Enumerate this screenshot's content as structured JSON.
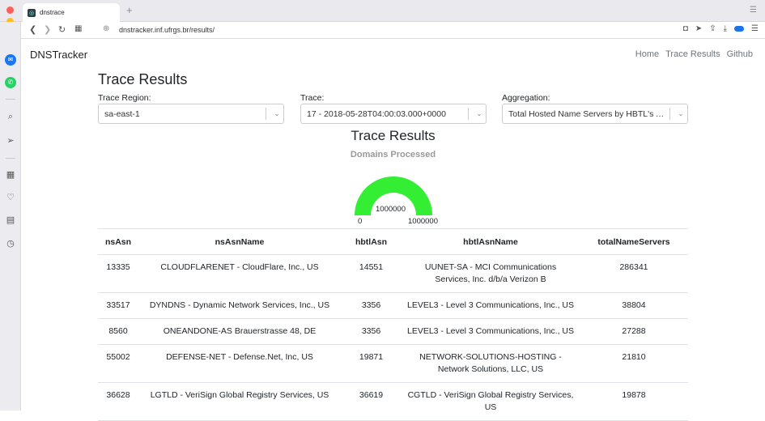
{
  "browser": {
    "tab_title": "dnstrace",
    "url": "dnstracker.inf.ufrgs.br/results/"
  },
  "site": {
    "brand": "DNSTracker",
    "nav": [
      "Home",
      "Trace Results",
      "Github"
    ]
  },
  "main": {
    "title": "Trace Results",
    "filters": {
      "region": {
        "label": "Trace Region:",
        "value": "sa-east-1"
      },
      "trace": {
        "label": "Trace:",
        "value": "17 - 2018-05-28T04:00:03.000+0000"
      },
      "aggregation": {
        "label": "Aggregation:",
        "value": "Total Hosted Name Servers by HBTL's A..."
      }
    }
  },
  "gauge": {
    "title": "Trace Results",
    "subtitle": "Domains Processed",
    "value_label": "1000000",
    "min_label": "0",
    "max_label": "1000000",
    "fill_fraction": 1.0,
    "color": "#33ee33"
  },
  "table": {
    "headers": [
      "nsAsn",
      "nsAsnName",
      "hbtlAsn",
      "hbtlAsnName",
      "totalNameServers"
    ],
    "rows": [
      [
        "13335",
        "CLOUDFLARENET - CloudFlare, Inc., US",
        "14551",
        "UUNET-SA - MCI Communications Services, Inc. d/b/a Verizon B",
        "286341"
      ],
      [
        "33517",
        "DYNDNS - Dynamic Network Services, Inc., US",
        "3356",
        "LEVEL3 - Level 3 Communications, Inc., US",
        "38804"
      ],
      [
        "8560",
        "ONEANDONE-AS Brauerstrasse 48, DE",
        "3356",
        "LEVEL3 - Level 3 Communications, Inc., US",
        "27288"
      ],
      [
        "55002",
        "DEFENSE-NET - Defense.Net, Inc, US",
        "19871",
        "NETWORK-SOLUTIONS-HOSTING - Network Solutions, LLC, US",
        "21810"
      ],
      [
        "36628",
        "LGTLD - VeriSign Global Registry Services, US",
        "36619",
        "CGTLD - VeriSign Global Registry Services, US",
        "19878"
      ]
    ]
  }
}
